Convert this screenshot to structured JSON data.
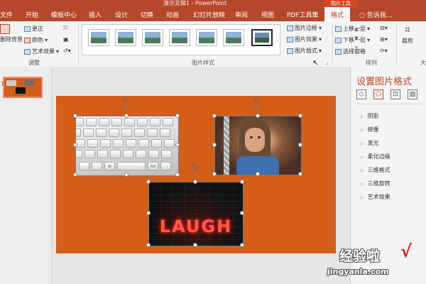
{
  "window": {
    "title": "演示文稿1 - PowerPoint",
    "context_tab_group": "图片工具"
  },
  "tabs": [
    {
      "label": "文件"
    },
    {
      "label": "开始"
    },
    {
      "label": "模板中心"
    },
    {
      "label": "插入"
    },
    {
      "label": "设计"
    },
    {
      "label": "切换"
    },
    {
      "label": "动画"
    },
    {
      "label": "幻灯片放映"
    },
    {
      "label": "审阅"
    },
    {
      "label": "视图"
    },
    {
      "label": "PDF工具集"
    },
    {
      "label": "格式",
      "active": true
    }
  ],
  "search": {
    "placeholder": "告诉我..."
  },
  "ribbon": {
    "adjust": {
      "remove_bg": "删除背景",
      "corrections": "更正",
      "color": "颜色",
      "artistic": "艺术效果",
      "label": "调整"
    },
    "picture_styles": {
      "style_count": 7,
      "selected_index": 6,
      "border": "图片边框",
      "effects": "图片效果",
      "layout": "图片版式",
      "label": "图片样式"
    },
    "arrange": {
      "bring_forward": "上移一层",
      "send_backward": "下移一层",
      "selection_pane": "选择窗格",
      "label": "排列"
    },
    "size": {
      "crop": "裁剪",
      "label_partial": "大"
    }
  },
  "thumbnails": [
    {
      "number": "1"
    }
  ],
  "slide": {
    "pictures": [
      {
        "name": "keyboard",
        "text": "Alt"
      },
      {
        "name": "girl"
      },
      {
        "name": "laugh",
        "text": "LAUGH"
      }
    ]
  },
  "format_pane": {
    "title": "设置图片格式",
    "tab_icons": [
      "fill-line-icon",
      "effects-icon",
      "size-properties-icon",
      "picture-icon"
    ],
    "items": [
      "阴影",
      "映像",
      "发光",
      "柔化边缘",
      "三维格式",
      "三维旋转",
      "艺术效果"
    ]
  },
  "watermark": {
    "brand": "经验啦",
    "check": "√",
    "url": "jingyanla.com"
  },
  "colors": {
    "accent": "#b7472a",
    "slide_bg": "#d35e19"
  }
}
